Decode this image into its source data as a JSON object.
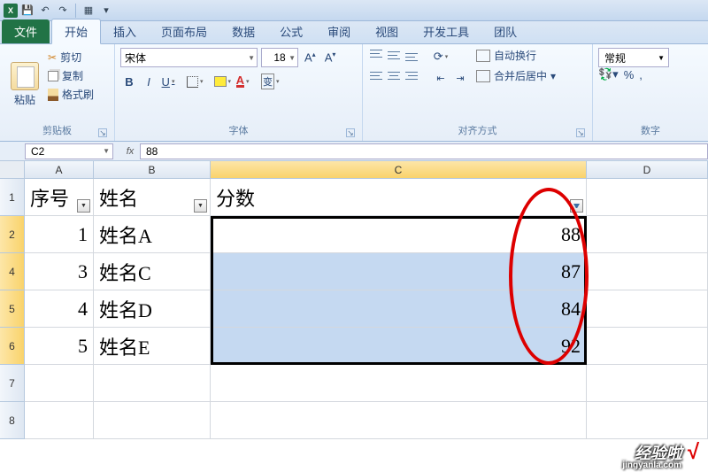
{
  "qat": {
    "app_letter": "X"
  },
  "tabs": {
    "file": "文件",
    "items": [
      "开始",
      "插入",
      "页面布局",
      "数据",
      "公式",
      "审阅",
      "视图",
      "开发工具",
      "团队"
    ],
    "active_index": 0
  },
  "ribbon": {
    "clipboard": {
      "paste": "粘贴",
      "cut": "剪切",
      "copy": "复制",
      "format": "格式刷",
      "label": "剪贴板"
    },
    "font": {
      "name": "宋体",
      "size": "18",
      "bold": "B",
      "italic": "I",
      "underline": "U",
      "wen": "变",
      "label": "字体"
    },
    "align": {
      "wrap": "自动换行",
      "merge": "合并后居中",
      "label": "对齐方式"
    },
    "number": {
      "format": "常规",
      "percent": "%",
      "comma": ",",
      "label": "数字"
    }
  },
  "namebox": {
    "ref": "C2",
    "fx": "fx",
    "value": "88"
  },
  "columns": [
    "A",
    "B",
    "C",
    "D"
  ],
  "headers": {
    "seq": "序号",
    "name": "姓名",
    "score": "分数"
  },
  "rows": [
    {
      "n": "2",
      "seq": "1",
      "name": "姓名A",
      "score": "88"
    },
    {
      "n": "4",
      "seq": "3",
      "name": "姓名C",
      "score": "87"
    },
    {
      "n": "5",
      "seq": "4",
      "name": "姓名D",
      "score": "84"
    },
    {
      "n": "6",
      "seq": "5",
      "name": "姓名E",
      "score": "92"
    }
  ],
  "empty_rows": [
    "7",
    "8"
  ],
  "watermark": {
    "text": "经验啦",
    "url": "jingyanla.com",
    "check": "√"
  },
  "chart_data": {
    "type": "table",
    "columns": [
      "序号",
      "姓名",
      "分数"
    ],
    "rows": [
      [
        1,
        "姓名A",
        88
      ],
      [
        3,
        "姓名C",
        87
      ],
      [
        4,
        "姓名D",
        84
      ],
      [
        5,
        "姓名E",
        92
      ]
    ],
    "note": "Row 3 (序号 2) hidden by filter on 分数 column"
  }
}
